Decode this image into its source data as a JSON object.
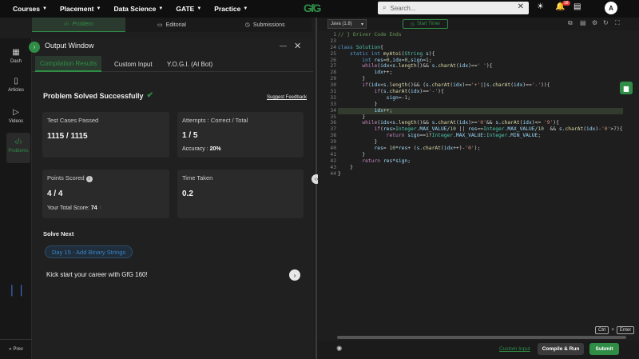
{
  "topnav": {
    "items": [
      "Courses",
      "Placement",
      "Data Science",
      "GATE",
      "Practice"
    ],
    "logo": "GfG",
    "search_placeholder": "Search...",
    "notif_count": "18",
    "avatar": "A"
  },
  "sidebar": {
    "items": [
      "Dash",
      "Articles",
      "Videos",
      "Problems"
    ],
    "prev": "Prev"
  },
  "question_tabs": [
    "Problem",
    "Editorial",
    "Submissions"
  ],
  "output": {
    "title": "Output Window",
    "tabs": [
      "Compilation Results",
      "Custom Input",
      "Y.O.G.I. (AI Bot)"
    ],
    "status": "Problem Solved Successfully",
    "suggest_feedback": "Suggest Feedback",
    "test_cases_label": "Test Cases Passed",
    "test_cases_value": "1115 / 1115",
    "attempts_label": "Attempts : Correct / Total",
    "attempts_value": "1 / 5",
    "accuracy_label": "Accuracy :",
    "accuracy_value": "20%",
    "points_label": "Points Scored",
    "points_value": "4 / 4",
    "total_score_label": "Your Total Score:",
    "total_score_value": "74",
    "time_label": "Time Taken",
    "time_value": "0.2",
    "solve_next": "Solve Next",
    "next_problem": "Day 15 - Add Binary Strings",
    "kickstart": "Kick start your career with GfG 160!"
  },
  "editor": {
    "language": "Java (1.8)",
    "timer": "Start Timer",
    "line_numbers": [
      "1",
      "23",
      "24",
      "25",
      "26",
      "27",
      "28",
      "29",
      "30",
      "31",
      "32",
      "33",
      "34",
      "35",
      "36",
      "37",
      "38",
      "39",
      "40",
      "41",
      "42",
      "43",
      "44"
    ],
    "shortcut_ctrl": "Ctrl",
    "shortcut_plus": "+",
    "shortcut_enter": "Enter",
    "custom_input": "Custom Input",
    "compile_run": "Compile & Run",
    "submit": "Submit"
  },
  "colors": {
    "accent": "#2f8d46",
    "background": "#1e1e1e",
    "card": "#2a2a2a",
    "link_blue": "#3b82c4"
  }
}
